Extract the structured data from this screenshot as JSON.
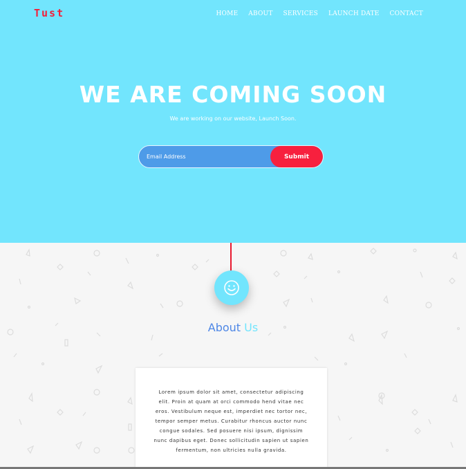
{
  "brand": {
    "logo": "Tust"
  },
  "nav": {
    "items": [
      "HOME",
      "ABOUT",
      "SERVICES",
      "LAUNCH DATE",
      "CONTACT"
    ]
  },
  "hero": {
    "headline": "WE ARE COMING SOON",
    "subline": "We are working on our website, Launch Soon.",
    "email_placeholder": "Email Address",
    "submit_label": "Submit"
  },
  "about": {
    "title_part1": "About",
    "title_part2": "Us",
    "icon": "smiley-icon",
    "body": "Lorem ipsum dolor sit amet, consectetur adipiscing elit. Proin at quam at orci commodo hend vitae nec eros. Vestibulum neque est, imperdiet nec tortor nec, tempor semper metus. Curabitur rhoncus auctor nunc congue sodales. Sed posuere nisi ipsum, dignissim nunc dapibus eget. Donec sollicitudin sapien ut sapien fermentum, non ultricies nulla gravida."
  },
  "colors": {
    "hero_bg": "#72e5fd",
    "accent_red": "#f7203e",
    "input_blue": "#4e9be8",
    "about_blue": "#4e87e6",
    "page_bg": "#f6f6f6"
  }
}
